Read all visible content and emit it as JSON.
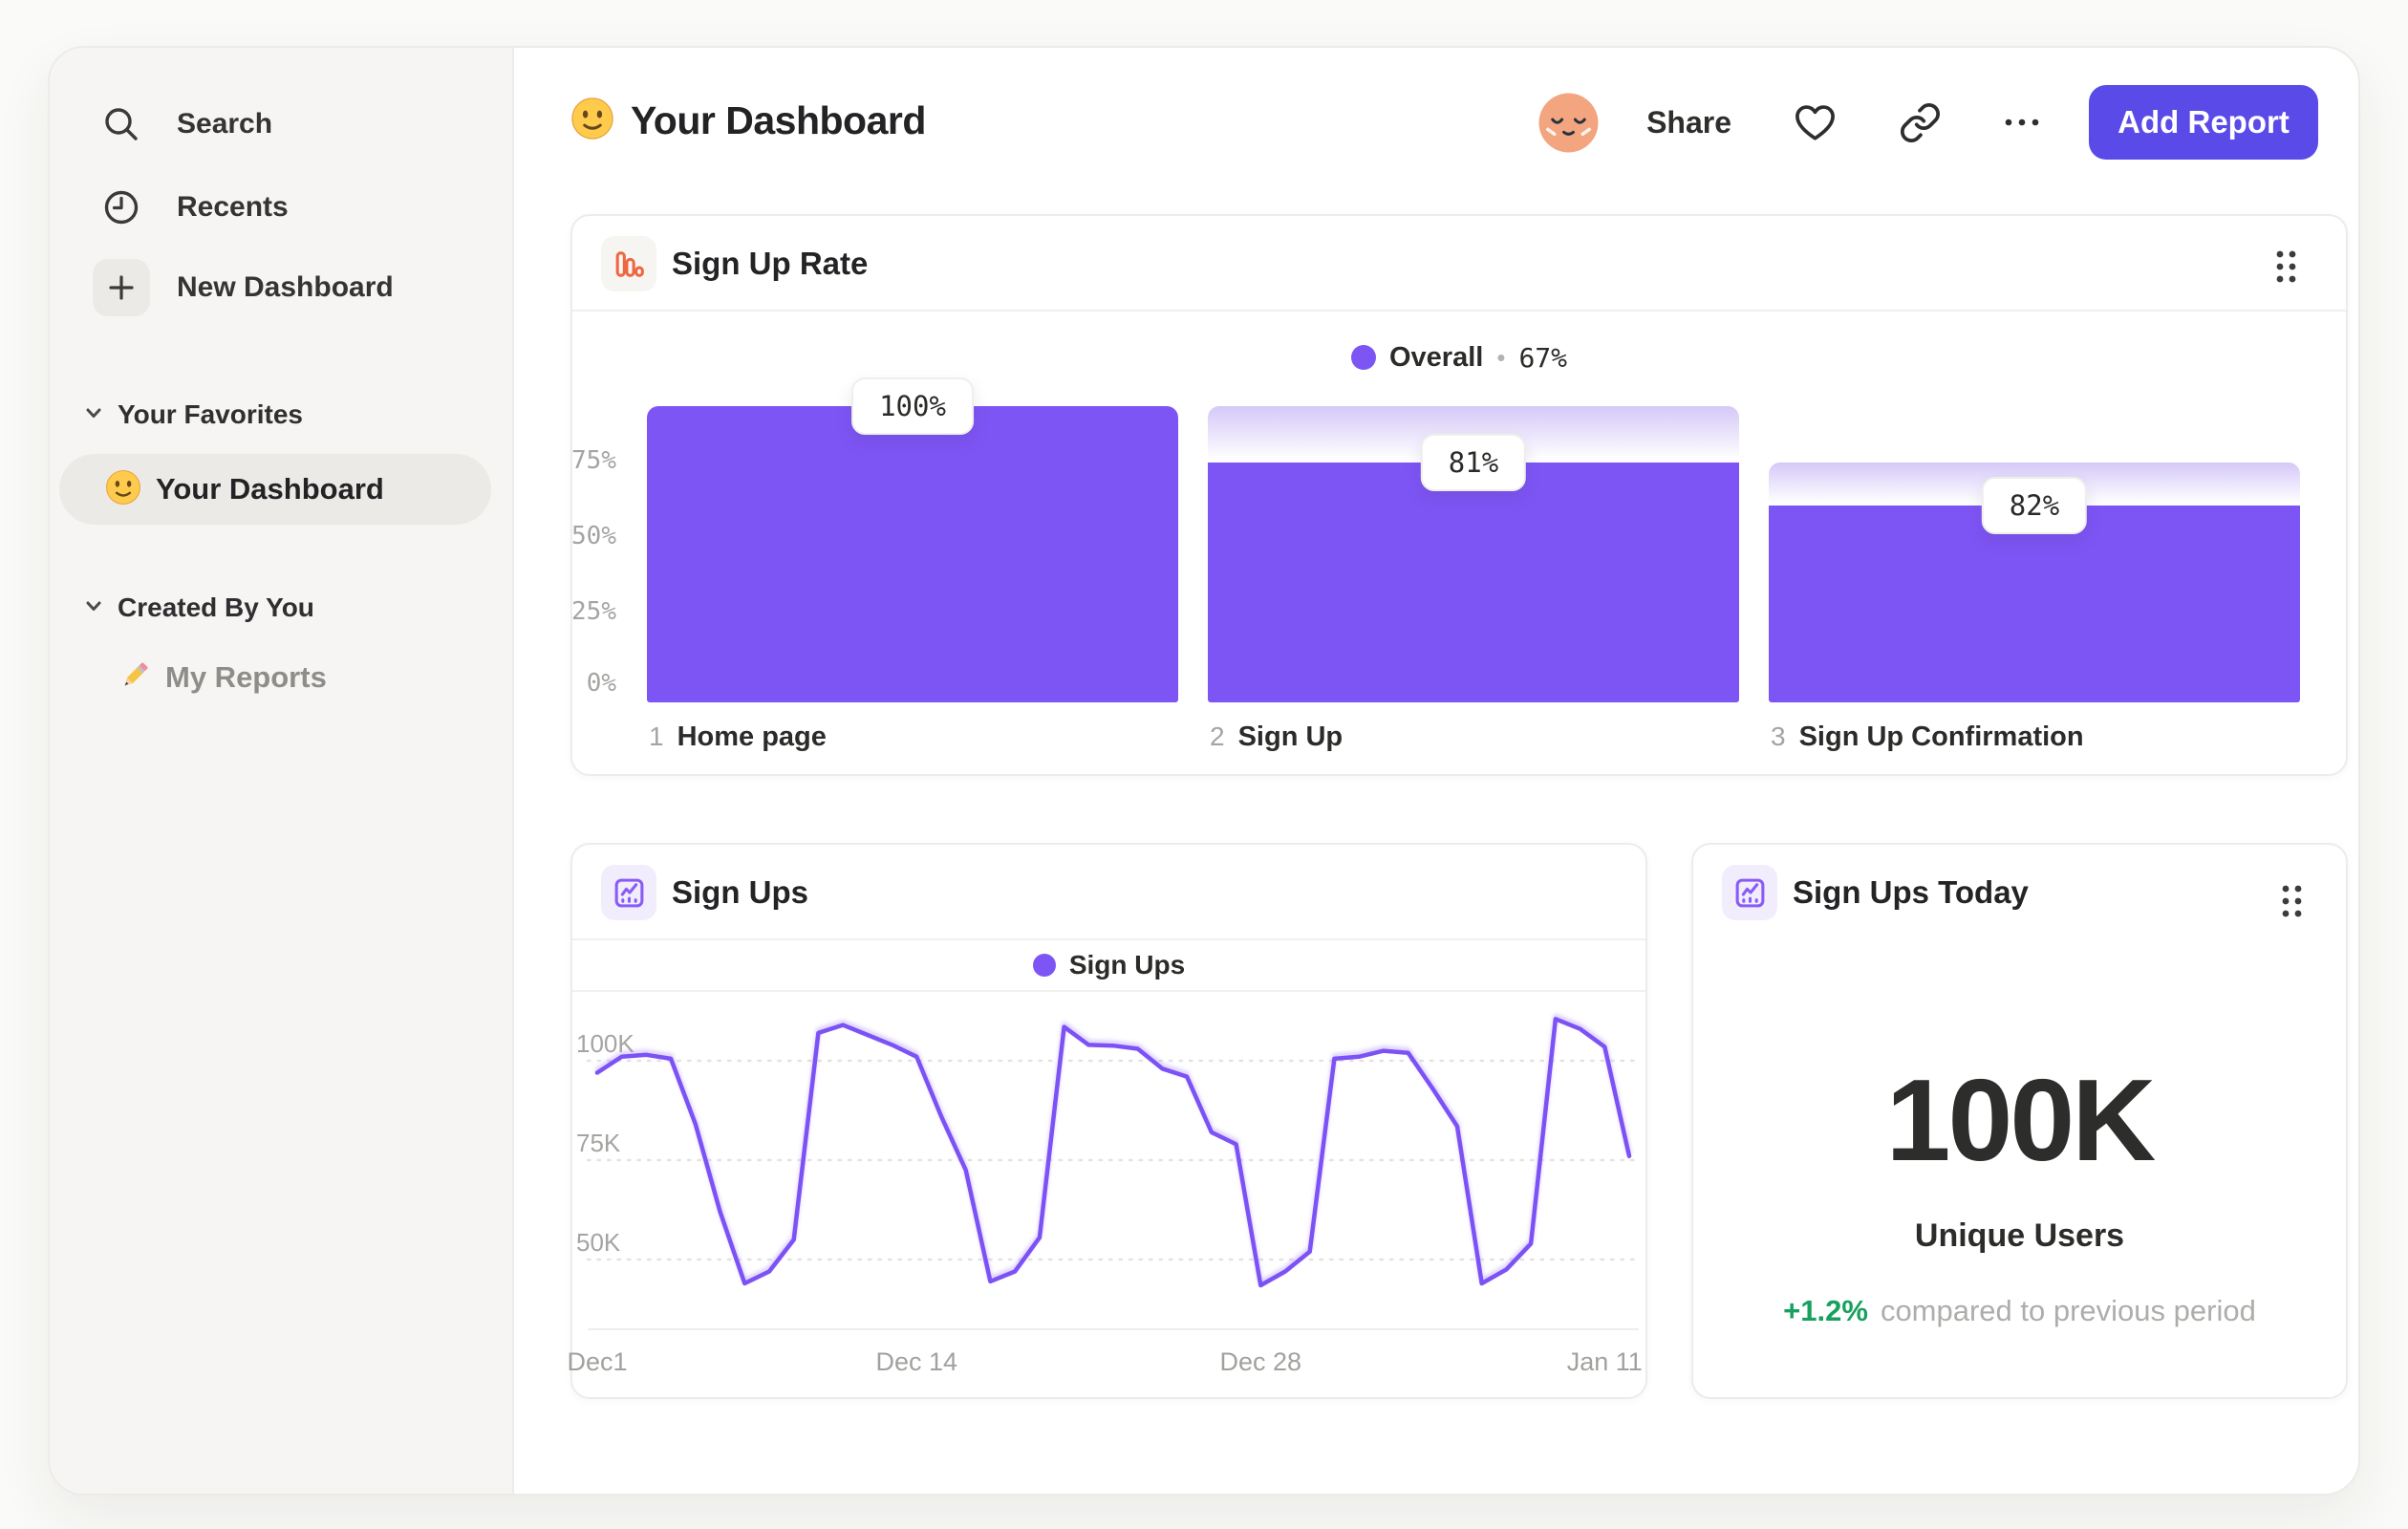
{
  "sidebar": {
    "nav": [
      {
        "label": "Search",
        "icon": "search"
      },
      {
        "label": "Recents",
        "icon": "clock"
      },
      {
        "label": "New Dashboard",
        "icon": "plus"
      }
    ],
    "sections": [
      {
        "title": "Your Favorites",
        "items": [
          {
            "label": "Your Dashboard",
            "icon": "smiley-emoji",
            "selected": true
          }
        ]
      },
      {
        "title": "Created By You",
        "items": [
          {
            "label": "My Reports",
            "icon": "pencil-emoji",
            "selected": false
          }
        ]
      }
    ]
  },
  "header": {
    "title": "Your Dashboard",
    "share_label": "Share",
    "add_report_label": "Add Report"
  },
  "signup_rate_card": {
    "title": "Sign Up Rate",
    "legend": {
      "name": "Overall",
      "separator": "•",
      "value": "67%"
    }
  },
  "signups_card": {
    "title": "Sign Ups",
    "legend": {
      "name": "Sign Ups"
    }
  },
  "signups_today_card": {
    "title": "Sign Ups Today",
    "value": "100K",
    "value_label": "Unique Users",
    "delta": "+1.2%",
    "delta_caption": "compared to previous period"
  },
  "colors": {
    "accent_purple": "#7E55F5",
    "line_purple": "#7C52F4",
    "button_indigo": "#5A4AE8",
    "icon_orange": "#ED6742",
    "delta_green": "#17A05E"
  },
  "chart_data": [
    {
      "type": "bar",
      "subtype": "funnel",
      "title": "Sign Up Rate",
      "legend": "Overall • 67%",
      "overall_conversion_pct": 67,
      "y_ticks": [
        "75%",
        "50%",
        "25%",
        "0%"
      ],
      "y_range": [
        0,
        100
      ],
      "steps": [
        {
          "index": "1",
          "name": "Home page",
          "label": "100%",
          "conversion_from_prev_pct": 100,
          "cumulative_pct": 100,
          "prev_cumulative_pct": 100
        },
        {
          "index": "2",
          "name": "Sign Up",
          "label": "81%",
          "conversion_from_prev_pct": 81,
          "cumulative_pct": 81,
          "prev_cumulative_pct": 100
        },
        {
          "index": "3",
          "name": "Sign Up Confirmation",
          "label": "82%",
          "conversion_from_prev_pct": 82,
          "cumulative_pct": 66.4,
          "prev_cumulative_pct": 81
        }
      ]
    },
    {
      "type": "line",
      "title": "Sign Ups",
      "legend": "Sign Ups",
      "unit": "thousands of sign ups per day",
      "x_ticks": [
        {
          "label": "Dec1",
          "day": 0
        },
        {
          "label": "Dec 14",
          "day": 13
        },
        {
          "label": "Dec 28",
          "day": 27
        },
        {
          "label": "Jan 11",
          "day": 41
        }
      ],
      "y_ticks": [
        {
          "label": "100K",
          "value": 100
        },
        {
          "label": "75K",
          "value": 75
        },
        {
          "label": "50K",
          "value": 50
        }
      ],
      "y_range_thousands": [
        32,
        116
      ],
      "gridlines": "dashed",
      "legend_position": "top-center",
      "values_thousands": [
        97,
        101,
        101.5,
        100.5,
        84,
        62,
        44,
        47,
        55,
        107,
        109,
        106.5,
        104,
        101,
        86,
        72.5,
        44.5,
        47,
        55.5,
        108.5,
        104,
        103.8,
        103,
        98,
        96,
        82,
        79,
        43.5,
        47,
        52,
        100.5,
        101,
        102.5,
        102,
        93,
        83.5,
        44,
        47.5,
        54,
        110.5,
        108,
        103.5,
        76
      ]
    }
  ]
}
